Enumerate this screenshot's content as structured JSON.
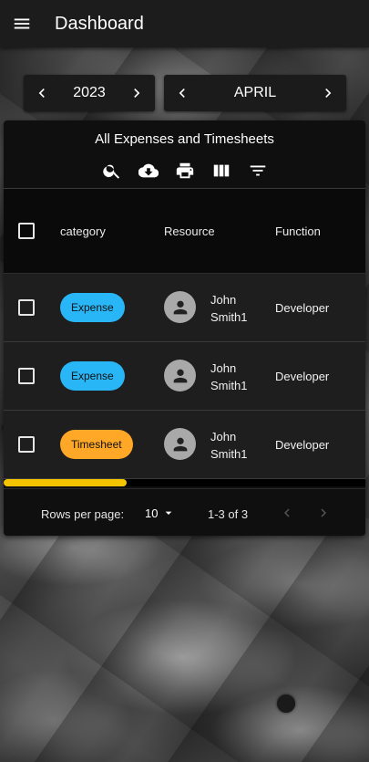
{
  "appbar": {
    "title": "Dashboard",
    "menu_icon": "menu-icon"
  },
  "year_selector": {
    "value": "2023",
    "prev_icon": "chevron-left-icon",
    "next_icon": "chevron-right-icon"
  },
  "month_selector": {
    "value": "APRIL",
    "prev_icon": "chevron-left-icon",
    "next_icon": "chevron-right-icon"
  },
  "table": {
    "title": "All Expenses and Timesheets",
    "toolbar_icons": [
      "search-icon",
      "download-icon",
      "print-icon",
      "view-columns-icon",
      "filter-icon"
    ],
    "columns": [
      "category",
      "Resource",
      "Function"
    ],
    "rows": [
      {
        "category": "Expense",
        "category_color": "#29b6f6",
        "resource_line1": "John",
        "resource_line2": "Smith1",
        "function": "Developer"
      },
      {
        "category": "Expense",
        "category_color": "#29b6f6",
        "resource_line1": "John",
        "resource_line2": "Smith1",
        "function": "Developer"
      },
      {
        "category": "Timesheet",
        "category_color": "#ffa726",
        "resource_line1": "John",
        "resource_line2": "Smith1",
        "function": "Developer"
      }
    ],
    "scroll_position_fraction": 0.0,
    "scroll_visible_fraction": 0.34,
    "scroll_color": "#f5c400"
  },
  "pagination": {
    "rows_per_page_label": "Rows per page:",
    "rows_per_page_value": "10",
    "range_label": "1-3 of 3"
  }
}
